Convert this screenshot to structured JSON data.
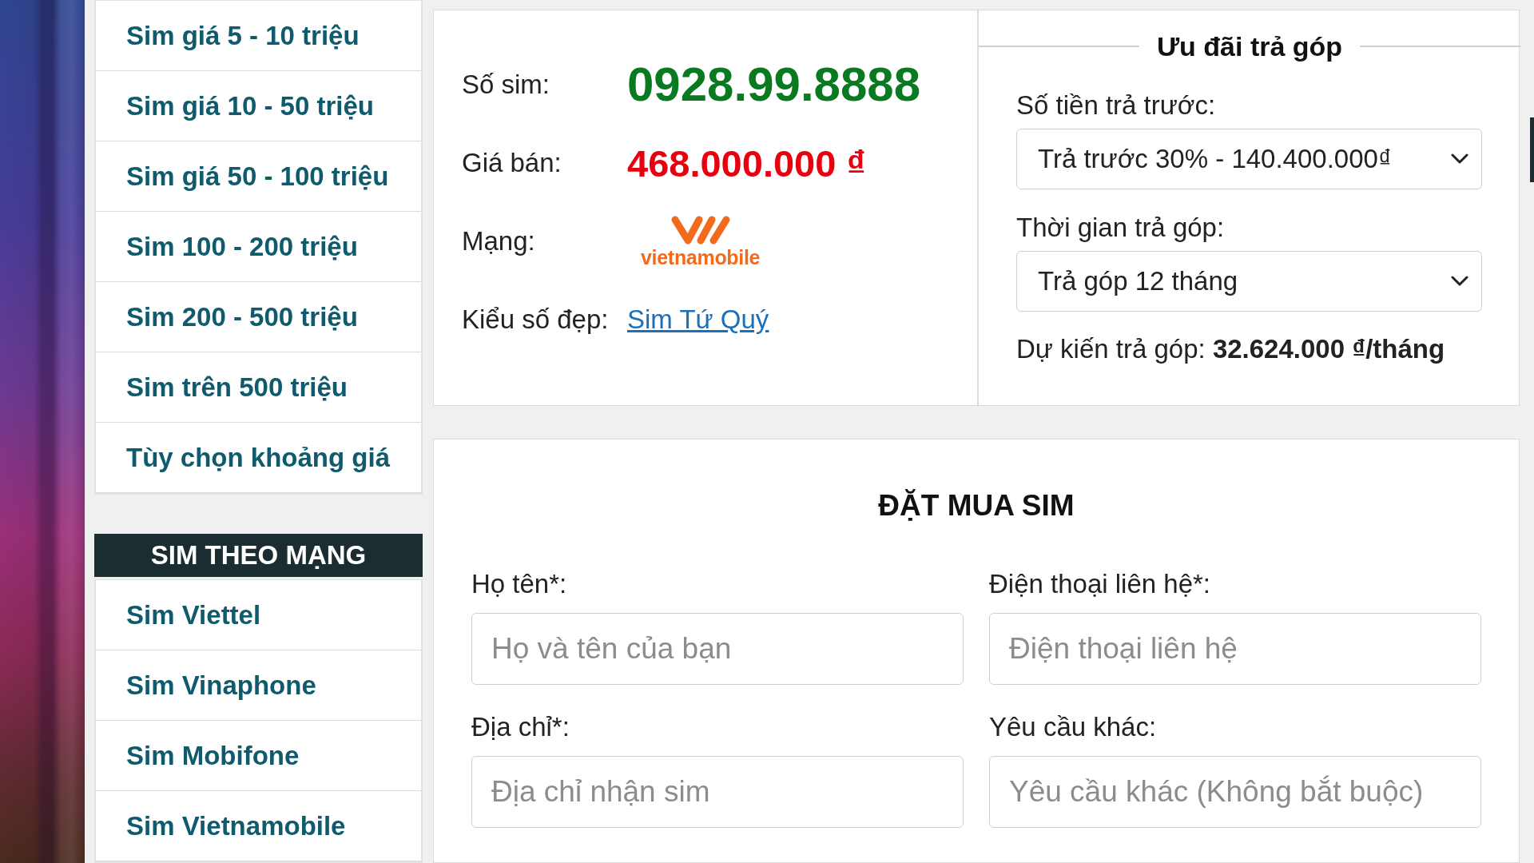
{
  "sidebar": {
    "price_menu": [
      {
        "label": "Sim giá 5 - 10 triệu"
      },
      {
        "label": "Sim giá 10 - 50 triệu"
      },
      {
        "label": "Sim giá 50 - 100 triệu"
      },
      {
        "label": "Sim 100 - 200 triệu"
      },
      {
        "label": "Sim 200 - 500 triệu"
      },
      {
        "label": "Sim trên 500 triệu"
      },
      {
        "label": "Tùy chọn khoảng giá"
      }
    ],
    "network_menu": {
      "title": "SIM THEO MẠNG",
      "items": [
        {
          "label": "Sim Viettel"
        },
        {
          "label": "Sim Vinaphone"
        },
        {
          "label": "Sim Mobifone"
        },
        {
          "label": "Sim Vietnamobile"
        }
      ]
    }
  },
  "sim_details": [
    {
      "kind": "number",
      "label": "Số sim:",
      "value": "0928.99.8888"
    },
    {
      "kind": "price",
      "label": "Giá bán:",
      "value": "468.000.000 ₫"
    },
    {
      "kind": "logo",
      "label": "Mạng:",
      "value": "vietnamobile"
    },
    {
      "kind": "link",
      "label": "Kiểu số đẹp:",
      "value": "Sim Tứ Quý"
    }
  ],
  "installment": {
    "title": "Ưu đãi trả góp",
    "selects": [
      {
        "label": "Số tiền trả trước:",
        "value": "Trả trước 30% - 140.400.000₫"
      },
      {
        "label": "Thời gian trả góp:",
        "value": "Trả góp 12 tháng"
      }
    ],
    "estimate": "Dự kiến trả góp: **32.624.000 ₫/tháng**"
  },
  "order_form": {
    "title": "ĐẶT MUA SIM",
    "fields": [
      {
        "label": "Họ tên*:",
        "placeholder": "Họ và tên của bạn"
      },
      {
        "label": "Điện thoại liên hệ*:",
        "placeholder": "Điện thoại liên hệ"
      },
      {
        "label": "Địa chỉ*:",
        "placeholder": "Địa chỉ nhận sim"
      },
      {
        "label": "Yêu cầu khác:",
        "placeholder": "Yêu cầu khác (Không bắt buộc)"
      }
    ]
  }
}
